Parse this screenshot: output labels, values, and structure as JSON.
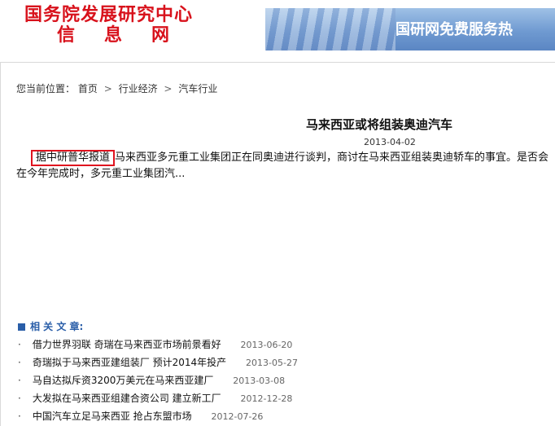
{
  "header": {
    "logo_line1": "国务院发展研究中心",
    "logo_line2": "信息网",
    "banner_text": "国研网免费服务热"
  },
  "breadcrumb": {
    "label": "您当前位置：",
    "items": [
      "首页",
      "行业经济",
      "汽车行业"
    ],
    "separator": ">"
  },
  "article": {
    "title": "马来西亚或将组装奥迪汽车",
    "date": "2013-04-02",
    "source_highlight": "据中研普华报道",
    "body": "马来西亚多元重工业集团正在同奥迪进行谈判，商讨在马来西亚组装奥迪轿车的事宜。是否会在今年完成时，多元重工业集团汽..."
  },
  "related": {
    "heading": "相 关 文 章:",
    "items": [
      {
        "title": "借力世界羽联 奇瑞在马来西亚市场前景看好",
        "date": "2013-06-20"
      },
      {
        "title": "奇瑞拟于马来西亚建组装厂 预计2014年投产",
        "date": "2013-05-27"
      },
      {
        "title": "马自达拟斥资3200万美元在马来西亚建厂",
        "date": "2013-03-08"
      },
      {
        "title": "大发拟在马来西亚组建合资公司 建立新工厂",
        "date": "2012-12-28"
      },
      {
        "title": "中国汽车立足马来西亚 抢占东盟市场",
        "date": "2012-07-26"
      }
    ]
  },
  "colors": {
    "logo_red": "#d8121c",
    "highlight_red": "#e0131f",
    "link_blue": "#2a5ea8"
  }
}
